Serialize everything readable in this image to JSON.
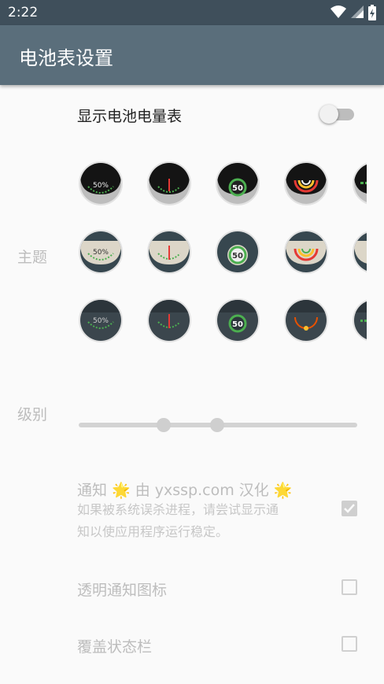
{
  "status_bar": {
    "time": "2:22"
  },
  "app_bar": {
    "title": "电池表设置"
  },
  "show_meter": {
    "label": "显示电池电量表",
    "enabled": false
  },
  "theme": {
    "label": "主题",
    "previews": [
      [
        "50%",
        "",
        "50",
        "",
        ""
      ],
      [
        "50%",
        "",
        "50",
        "",
        ""
      ],
      [
        "50%",
        "",
        "50",
        "",
        ""
      ]
    ]
  },
  "level": {
    "label": "级别"
  },
  "notification": {
    "title": "通知 🌟 由 yxssp.com 汉化 🌟",
    "summary_line1": "如果被系统误杀进程，请尝试显示通",
    "summary_line2": "知以使应用程序运行稳定。",
    "checked": true
  },
  "transparent_icon": {
    "label": "透明通知图标",
    "checked": false
  },
  "cover_status_bar": {
    "label": "覆盖状态栏",
    "checked": false
  }
}
